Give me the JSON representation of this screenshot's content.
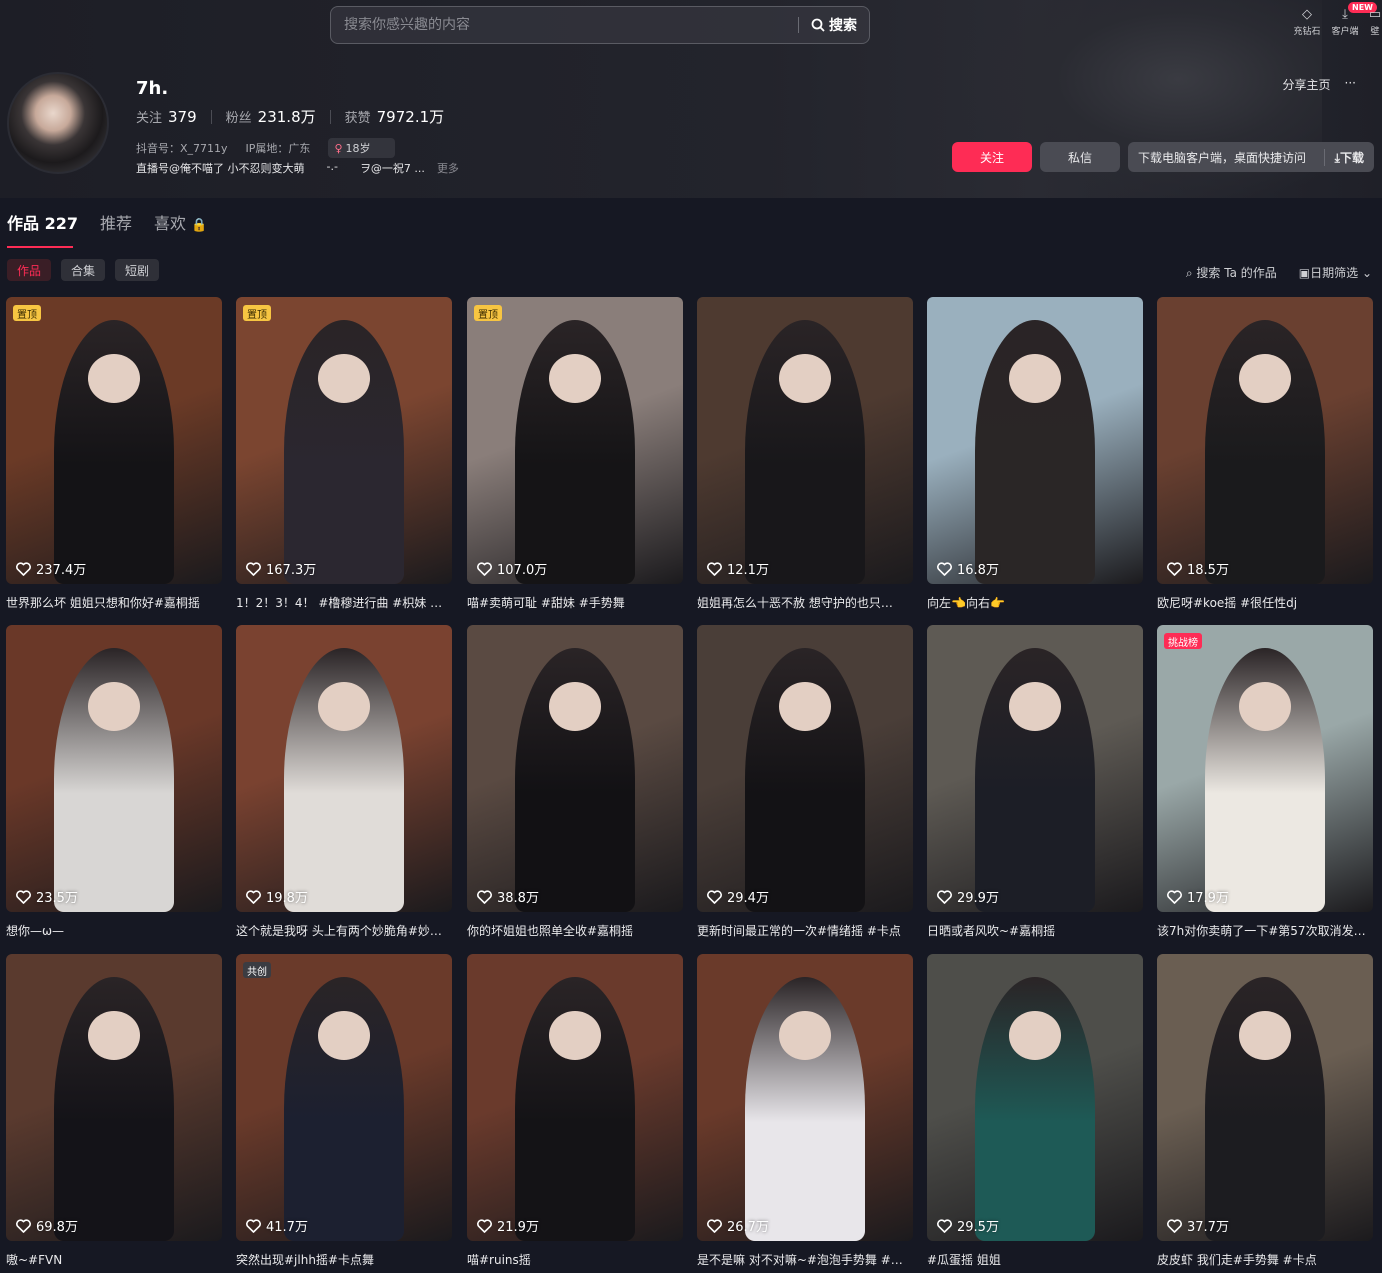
{
  "search": {
    "placeholder": "搜索你感兴趣的内容",
    "button": "搜索"
  },
  "topbar": {
    "items": [
      {
        "icon": "diamond-icon",
        "label": "充钻石"
      },
      {
        "icon": "download-icon",
        "label": "客户端",
        "badge": "NEW"
      },
      {
        "icon": "more-icon",
        "label": "壁"
      }
    ]
  },
  "profile": {
    "name": "7h.",
    "stats": [
      {
        "label": "关注",
        "value": "379"
      },
      {
        "label": "粉丝",
        "value": "231.8万"
      },
      {
        "label": "获赞",
        "value": "7972.1万"
      }
    ],
    "douyin_id": "抖音号：X_7711y",
    "ip": "IP属地：广东",
    "age": "18岁",
    "bio": [
      "直播号@俺不喵了 小不忍则变大萌",
      "-.-",
      "ヲ@一祝7 ...",
      "更多"
    ],
    "share": "分享主页",
    "more": "···"
  },
  "actions": {
    "follow": "关注",
    "message": "私信",
    "download_text": "下载电脑客户端，桌面快捷访问",
    "download_btn": "下载"
  },
  "tabs": [
    {
      "label": "作品",
      "count": "227"
    },
    {
      "label": "推荐"
    },
    {
      "label": "喜欢"
    }
  ],
  "chips": [
    "作品",
    "合集",
    "短剧"
  ],
  "tools": {
    "search": "搜索 Ta 的作品",
    "date": "日期筛选"
  },
  "videos": [
    {
      "tag": "置顶",
      "likes": "237.4万",
      "caption": "世界那么坏 姐姐只想和你好#嘉桐摇",
      "c1": "#6b3a26",
      "c2": "#141316"
    },
    {
      "tag": "置顶",
      "likes": "167.3万",
      "caption": "1！2！3！4！ #橹穆进行曲 #枳妹 #…",
      "c1": "#7b4530",
      "c2": "#2b2730"
    },
    {
      "tag": "置顶",
      "likes": "107.0万",
      "caption": "喵#卖萌可耻 #甜妹 #手势舞",
      "c1": "#8a7e7a",
      "c2": "#151416"
    },
    {
      "tag": "",
      "likes": "12.1万",
      "caption": "姐姐再怎么十恶不赦 想守护的也只…",
      "c1": "#4e3a30",
      "c2": "#18171a"
    },
    {
      "tag": "",
      "likes": "16.8万",
      "caption": "向左👈向右👉",
      "c1": "#9ab0be",
      "c2": "#2a2626"
    },
    {
      "tag": "",
      "likes": "18.5万",
      "caption": "欧尼呀#koe摇 #很任性dj",
      "c1": "#6a4030",
      "c2": "#1a1a1c"
    },
    {
      "tag": "",
      "likes": "23.5万",
      "caption": "想你—ω—",
      "c1": "#6a3828",
      "c2": "#d8d6d4"
    },
    {
      "tag": "",
      "likes": "19.8万",
      "caption": "这个就是我呀 头上有两个妙脆角#妙…",
      "c1": "#7a4230",
      "c2": "#e0dcd8"
    },
    {
      "tag": "",
      "likes": "38.8万",
      "caption": "你的坏姐姐也照单全收#嘉桐摇",
      "c1": "#5a4a42",
      "c2": "#121114"
    },
    {
      "tag": "",
      "likes": "29.4万",
      "caption": "更新时间最正常的一次#情绪摇 #卡点",
      "c1": "#4a3e38",
      "c2": "#131215"
    },
    {
      "tag": "",
      "likes": "29.9万",
      "caption": "日晒或者风吹~#嘉桐摇",
      "c1": "#5e5a54",
      "c2": "#1c1e26"
    },
    {
      "tag": "挑战榜",
      "likes": "17.9万",
      "caption": "该7h对你卖萌了一下#第57次取消发…",
      "c1": "#9aa8a8",
      "c2": "#ece8e2"
    },
    {
      "tag": "",
      "likes": "69.8万",
      "caption": "嗷~#FVN",
      "c1": "#5a3a2e",
      "c2": "#141318"
    },
    {
      "tag": "共创",
      "likes": "41.7万",
      "caption": "突然出现#jlhh摇#卡点舞",
      "c1": "#6a3a2a",
      "c2": "#1c2030"
    },
    {
      "tag": "",
      "likes": "21.9万",
      "caption": "喵#ruins摇",
      "c1": "#6a3a2c",
      "c2": "#141316"
    },
    {
      "tag": "",
      "likes": "26.7万",
      "caption": "是不是嘛 对不对嘛~#泡泡手势舞 #…",
      "c1": "#6a3a2a",
      "c2": "#e8e6ea"
    },
    {
      "tag": "",
      "likes": "29.5万",
      "caption": "#瓜蛋摇 姐姐",
      "c1": "#4e4e4a",
      "c2": "#1e5a56"
    },
    {
      "tag": "",
      "likes": "37.7万",
      "caption": "皮皮虾 我们走#手势舞 #卡点",
      "c1": "#6a5e52",
      "c2": "#1c1c20"
    }
  ]
}
